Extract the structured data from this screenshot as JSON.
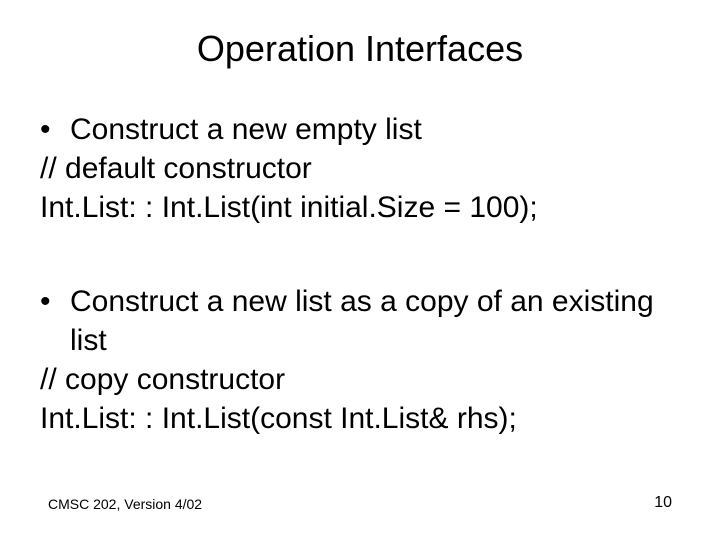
{
  "title": "Operation Interfaces",
  "section1": {
    "bullet": "Construct a new empty list",
    "line2": "// default constructor",
    "line3": "Int.List: : Int.List(int initial.Size = 100);"
  },
  "section2": {
    "bullet": "Construct a new list as a copy of an existing list",
    "line2": "// copy constructor",
    "line3": "Int.List: : Int.List(const Int.List& rhs);"
  },
  "footer": {
    "left": "CMSC 202, Version 4/02",
    "right": "10"
  }
}
